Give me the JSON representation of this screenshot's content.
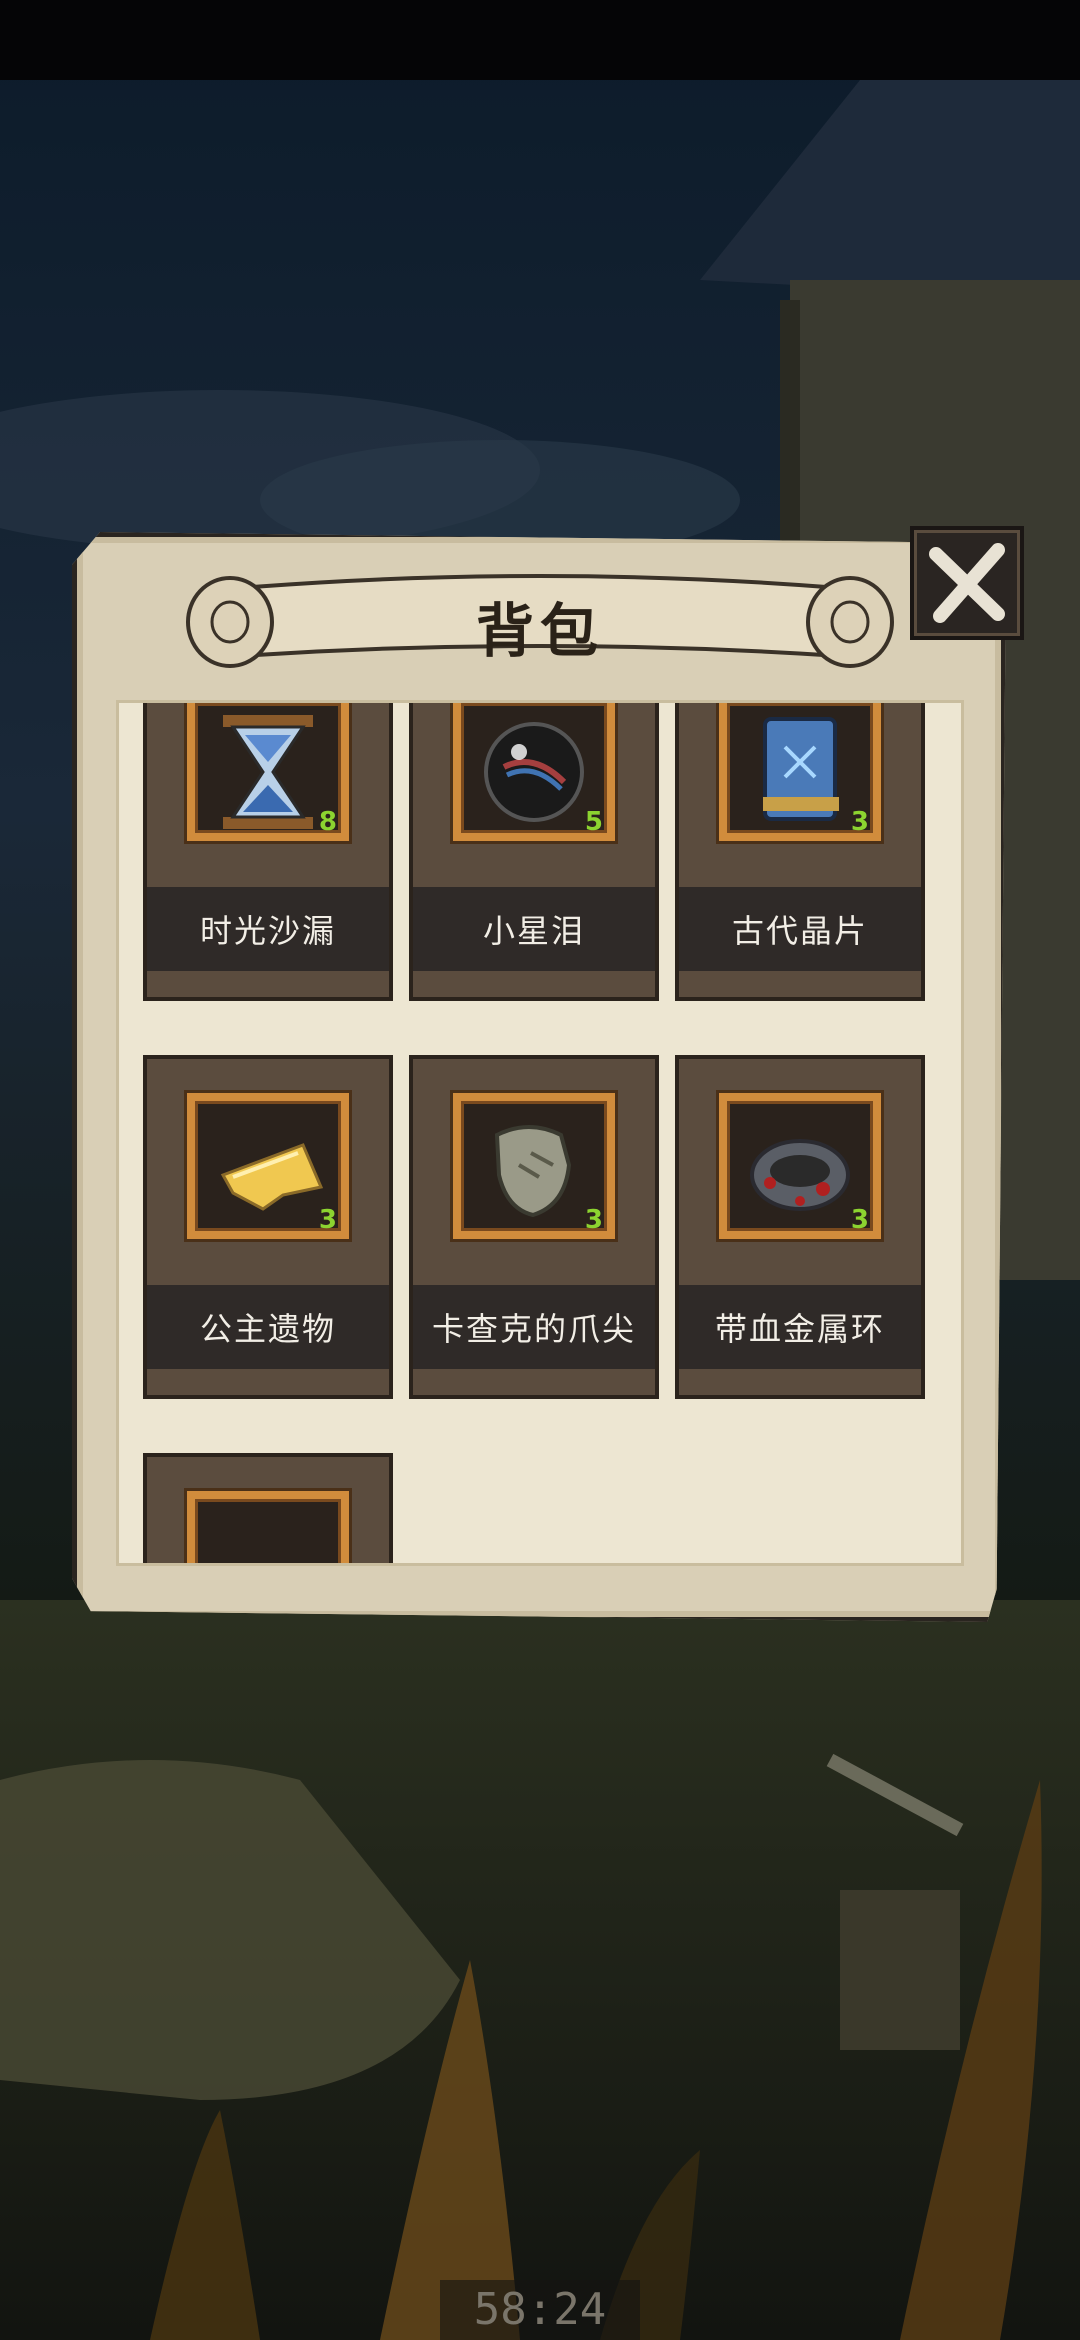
{
  "inventory": {
    "title": "背包",
    "items": [
      {
        "name": "时光沙漏",
        "count": "8",
        "icon": "hourglass-icon"
      },
      {
        "name": "小星泪",
        "count": "5",
        "icon": "star-tear-orb-icon"
      },
      {
        "name": "古代晶片",
        "count": "3",
        "icon": "ancient-crystal-chip-icon"
      },
      {
        "name": "公主遗物",
        "count": "3",
        "icon": "princess-relic-fragment-icon"
      },
      {
        "name": "卡查克的爪尖",
        "count": "3",
        "icon": "claw-tip-icon"
      },
      {
        "name": "带血金属环",
        "count": "3",
        "icon": "bloody-metal-ring-icon"
      }
    ]
  },
  "hud": {
    "timer": "58:24"
  },
  "colors": {
    "count_green": "#8cd430",
    "frame_orange": "#d18c3c",
    "panel_parchment": "#d9cfb6"
  }
}
